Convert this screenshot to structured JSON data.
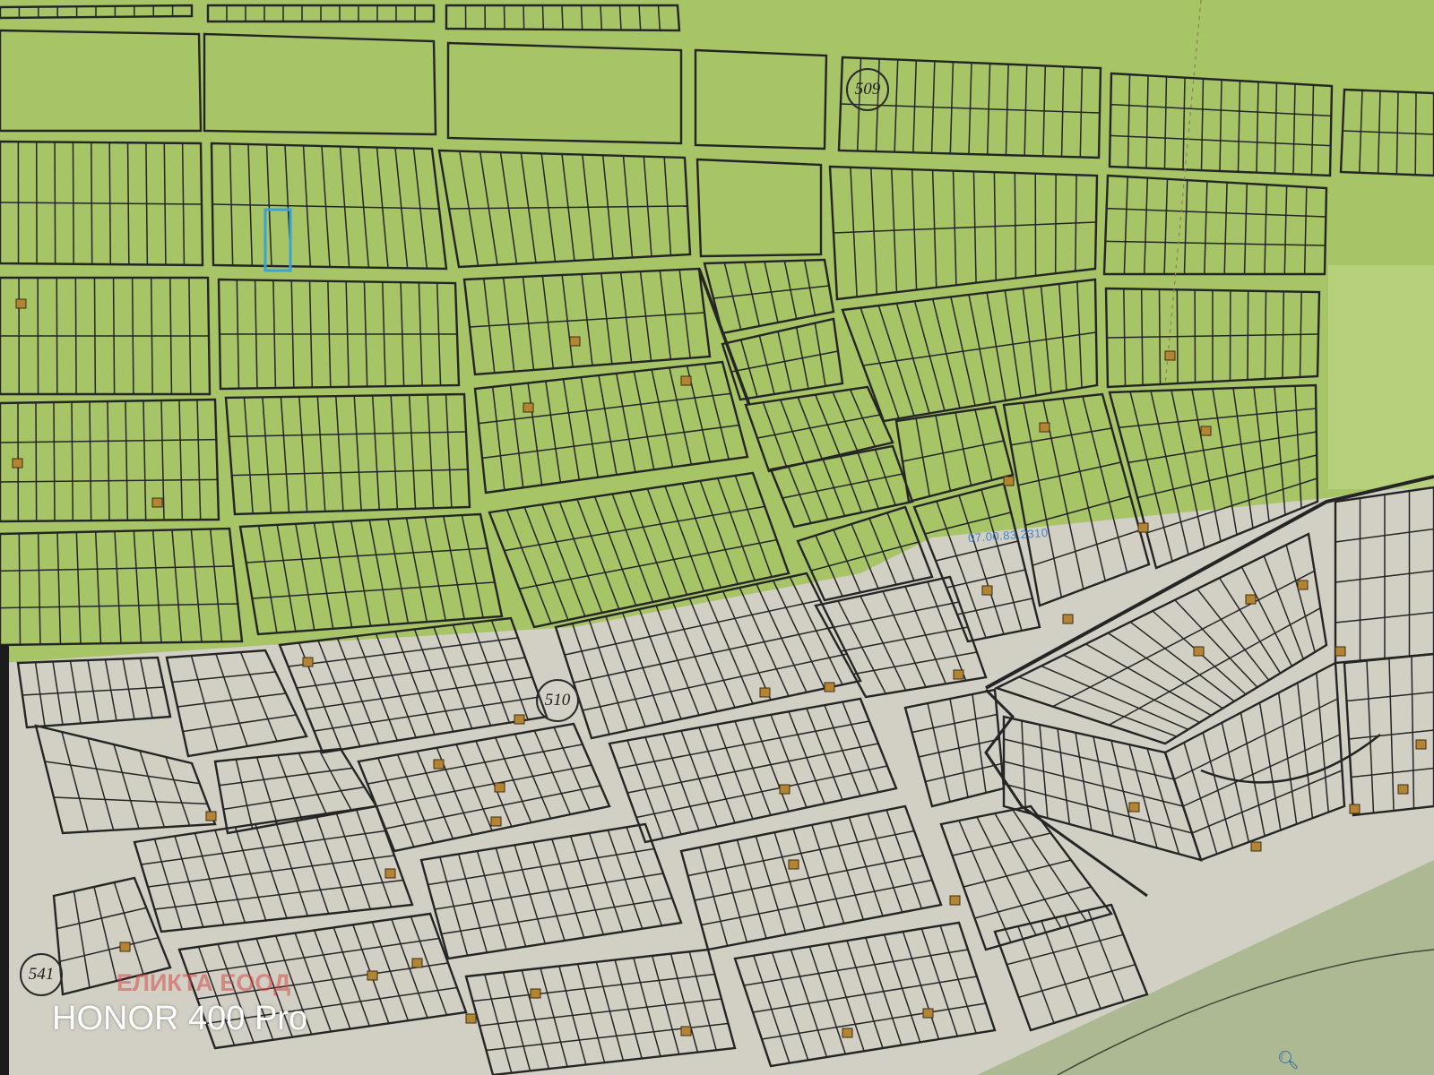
{
  "map": {
    "colors": {
      "green_zone": "#a7c466",
      "light_zone": "#d2cfc4",
      "parcel_line": "#252525",
      "street": "#dad9c6",
      "building": "#b48432",
      "highlight": "#39a2d6"
    },
    "district_markers": [
      {
        "id": "509",
        "label": "509"
      },
      {
        "id": "510",
        "label": "510"
      },
      {
        "id": "541",
        "label": "541"
      }
    ],
    "parcel_identifier": "07.00.83.2310",
    "firm_watermark": "ЕЛИКТА ЕООД",
    "camera_watermark": "HONOR 400 Pro",
    "search_icon": "magnifier-icon"
  }
}
